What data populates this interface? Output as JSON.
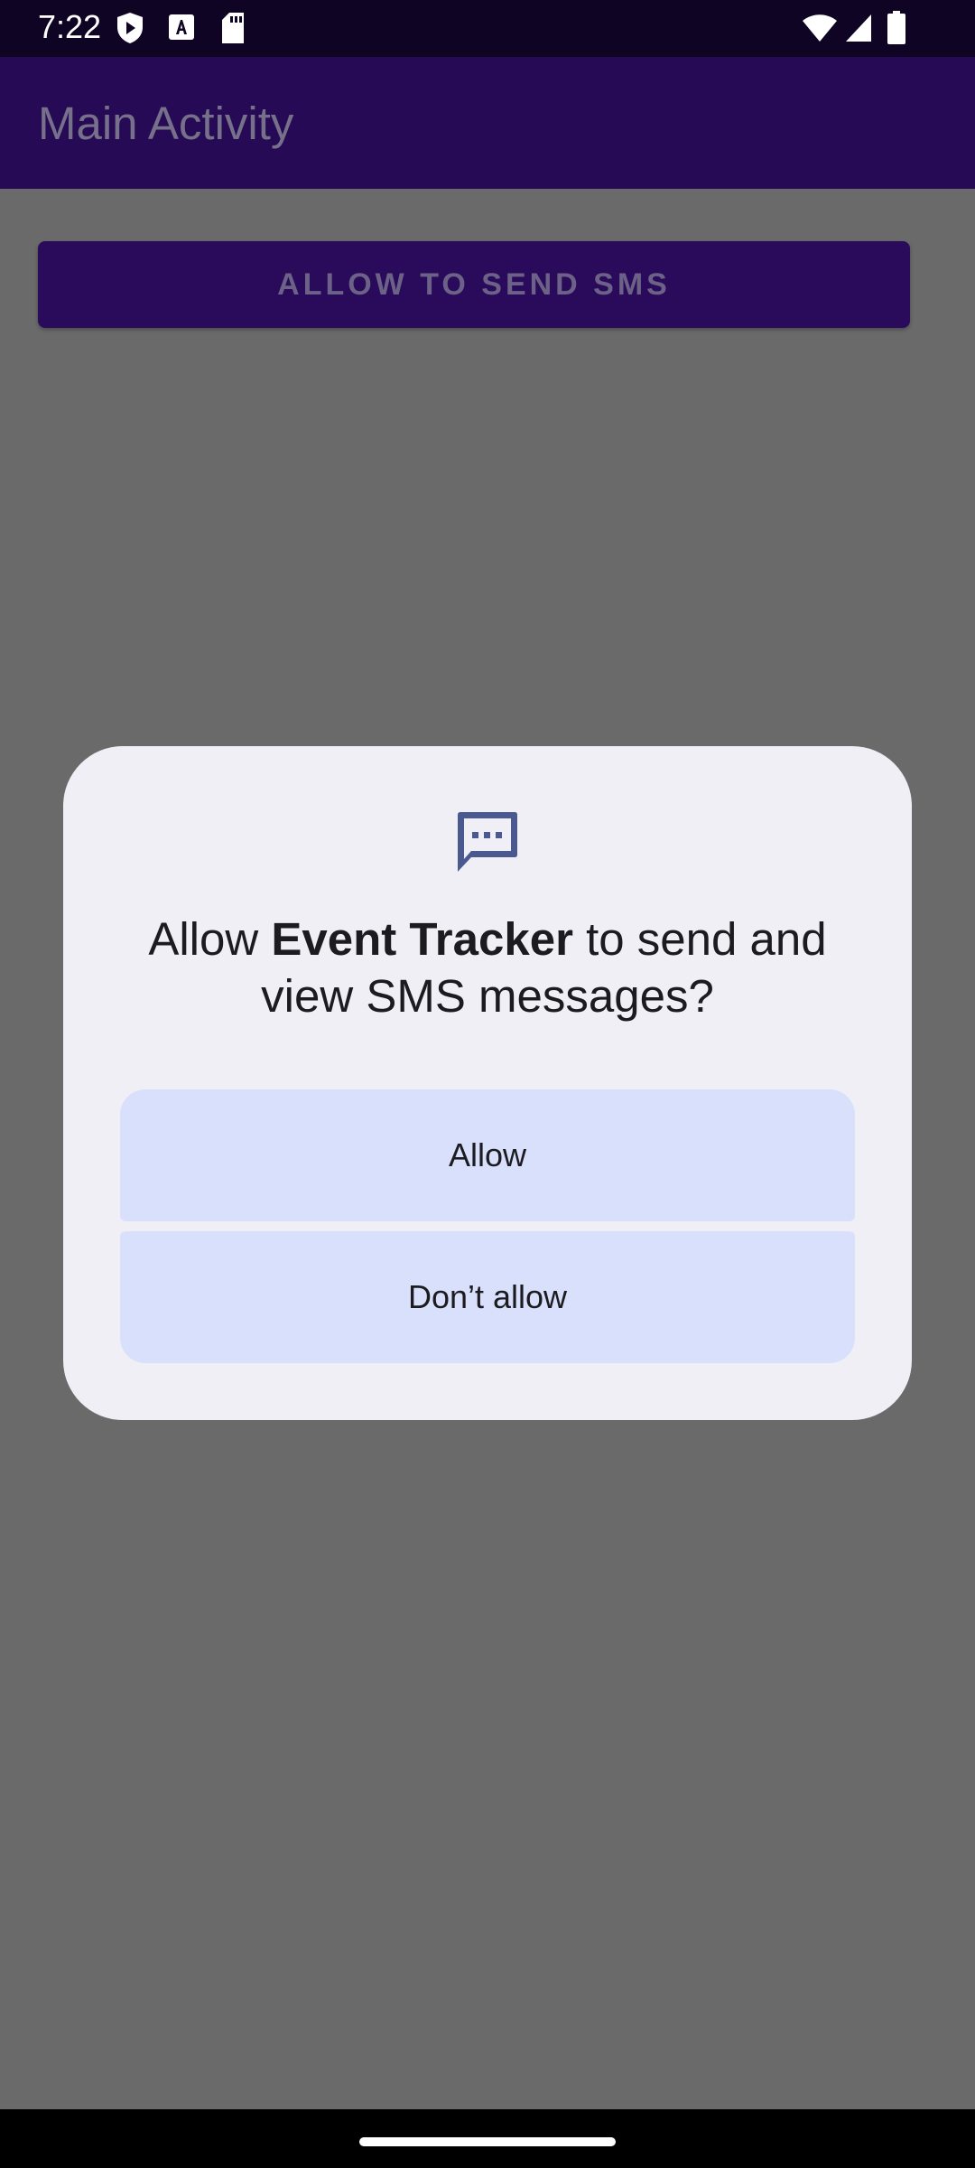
{
  "status_bar": {
    "time": "7:22",
    "left_icons": [
      "shield-play-icon",
      "font-a-icon",
      "sd-card-icon"
    ],
    "right_icons": [
      "wifi-icon",
      "cellular-signal-icon",
      "battery-icon"
    ]
  },
  "app_bar": {
    "title": "Main Activity"
  },
  "main": {
    "sms_button_label": "ALLOW TO SEND SMS"
  },
  "dialog": {
    "icon": "sms-message-icon",
    "title_prefix": "Allow ",
    "app_name": "Event Tracker",
    "title_suffix": " to send and view SMS messages?",
    "allow_label": "Allow",
    "deny_label": "Don’t allow"
  },
  "colors": {
    "status_bar": "#0f0424",
    "app_bar": "#260a55",
    "scrim_background": "#6a6a6a",
    "dialog_background": "#f0eff6",
    "dialog_button": "#d9e0fb",
    "icon_accent": "#4a5a91"
  }
}
